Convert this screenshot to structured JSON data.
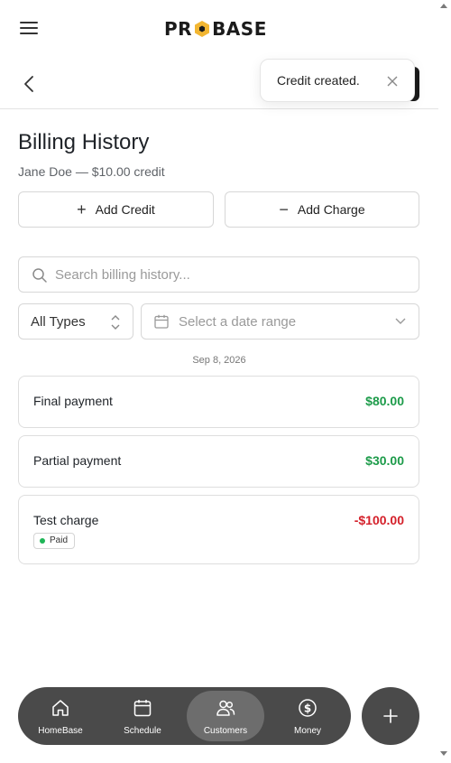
{
  "brand": {
    "logo_left": "PR",
    "logo_right": "BASE",
    "accent": "#f2b632"
  },
  "toast": {
    "message": "Credit created.",
    "icon": "close-icon"
  },
  "header": {
    "back_icon": "chevron-left-icon",
    "menu_icon": "hamburger-icon"
  },
  "page": {
    "title": "Billing History",
    "subtitle": "Jane Doe — $10.00 credit"
  },
  "actions": {
    "add_credit": {
      "label": "Add Credit",
      "icon": "plus-icon"
    },
    "add_charge": {
      "label": "Add Charge",
      "icon": "minus-icon"
    }
  },
  "search": {
    "placeholder": "Search billing history...",
    "value": ""
  },
  "filters": {
    "type": {
      "selected": "All Types"
    },
    "date": {
      "placeholder": "Select a date range"
    }
  },
  "history": {
    "date_label": "Sep 8, 2026",
    "entries": [
      {
        "name": "Final payment",
        "amount": "$80.00",
        "kind": "positive"
      },
      {
        "name": "Partial payment",
        "amount": "$30.00",
        "kind": "positive"
      },
      {
        "name": "Test charge",
        "amount": "-$100.00",
        "kind": "negative",
        "status": "Paid"
      }
    ]
  },
  "colors": {
    "positive": "#1d9b4a",
    "negative": "#d4202a",
    "nav_bg": "#4a4a4a",
    "nav_active": "#6d6d6d"
  },
  "nav": {
    "items": [
      {
        "label": "HomeBase",
        "icon": "home-icon"
      },
      {
        "label": "Schedule",
        "icon": "calendar-icon"
      },
      {
        "label": "Customers",
        "icon": "users-icon",
        "active": true
      },
      {
        "label": "Money",
        "icon": "dollar-circle-icon"
      }
    ],
    "fab_icon": "plus-icon"
  }
}
